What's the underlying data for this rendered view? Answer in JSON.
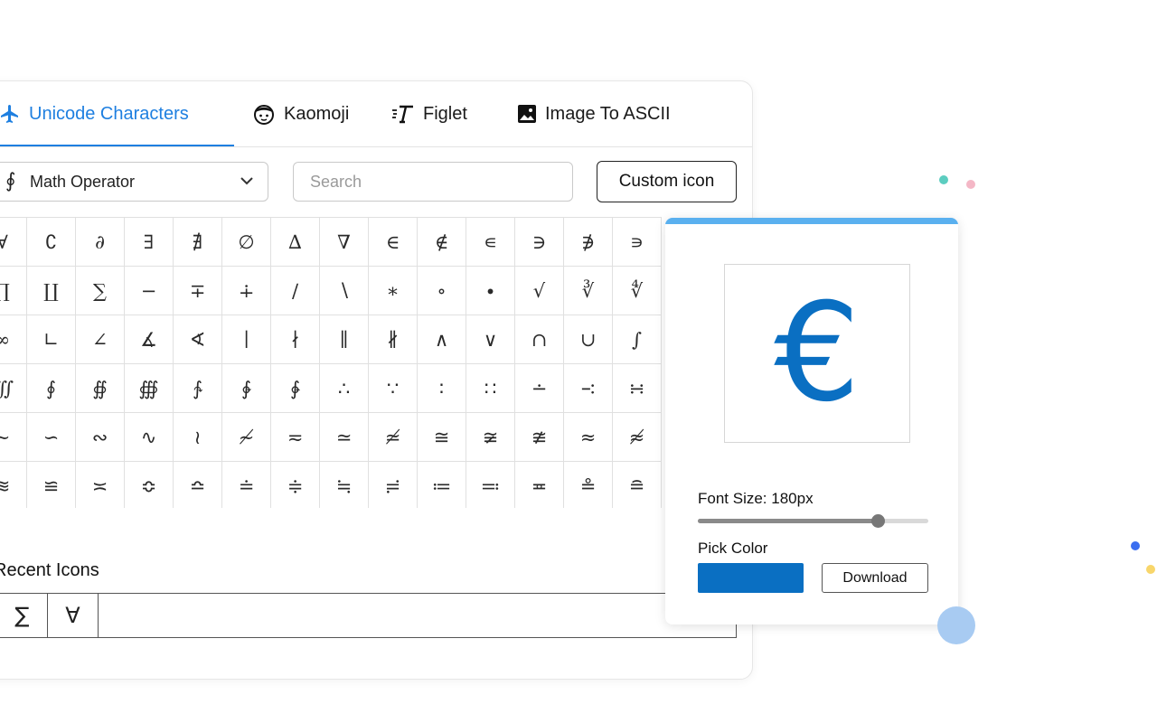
{
  "tabs": [
    {
      "label": "Unicode Characters",
      "icon": "airplane-icon",
      "active": true
    },
    {
      "label": "Kaomoji",
      "icon": "face-icon",
      "active": false
    },
    {
      "label": "Figlet",
      "icon": "text-style-icon",
      "active": false
    },
    {
      "label": "Image To ASCII",
      "icon": "image-icon",
      "active": false
    }
  ],
  "category_select": {
    "lead_glyph": "∮",
    "value": "Math Operator"
  },
  "search": {
    "placeholder": "Search",
    "value": ""
  },
  "custom_icon_button": {
    "label": "Custom icon"
  },
  "symbol_grid": [
    [
      "∀",
      "∁",
      "∂",
      "∃",
      "∄",
      "∅",
      "∆",
      "∇",
      "∈",
      "∉",
      "∊",
      "∋",
      "∌",
      "∍"
    ],
    [
      "∏",
      "∐",
      "∑",
      "−",
      "∓",
      "∔",
      "∕",
      "∖",
      "∗",
      "∘",
      "∙",
      "√",
      "∛",
      "∜"
    ],
    [
      "∞",
      "∟",
      "∠",
      "∡",
      "∢",
      "∣",
      "∤",
      "∥",
      "∦",
      "∧",
      "∨",
      "∩",
      "∪",
      "∫"
    ],
    [
      "∭",
      "∮",
      "∯",
      "∰",
      "∱",
      "∲",
      "∳",
      "∴",
      "∵",
      "∶",
      "∷",
      "∸",
      "∹",
      "∺"
    ],
    [
      "∼",
      "∽",
      "∾",
      "∿",
      "≀",
      "≁",
      "≂",
      "≃",
      "≄",
      "≅",
      "≆",
      "≇",
      "≈",
      "≉"
    ],
    [
      "≋",
      "≌",
      "≍",
      "≎",
      "≏",
      "≐",
      "≑",
      "≒",
      "≓",
      "≔",
      "≕",
      "≖",
      "≗",
      "≘"
    ]
  ],
  "recent": {
    "title": "Recent Icons",
    "items": [
      "∑",
      "∀"
    ]
  },
  "preview": {
    "glyph": "€",
    "font_size_label": "Font Size: 180px",
    "font_size_fraction": 0.78,
    "pick_color_label": "Pick Color",
    "color": "#0a6fc2",
    "download_label": "Download"
  },
  "colors": {
    "accent": "#1e7fe0",
    "preview_bar": "#5ab0ef"
  }
}
